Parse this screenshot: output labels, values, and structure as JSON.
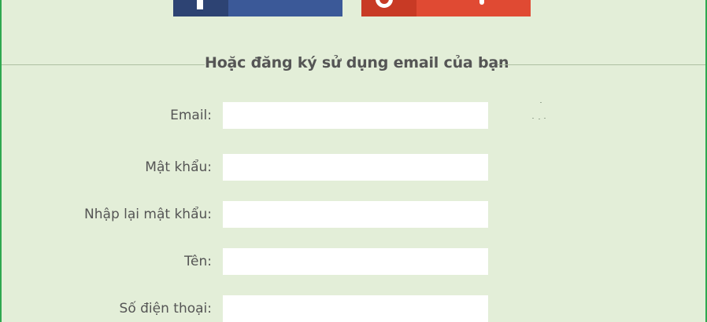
{
  "social": {
    "facebook_icon": "facebook-icon",
    "google_icon": "google-plus-icon",
    "facebook_color": "#3b5998",
    "google_color": "#e04a33"
  },
  "divider_text": "Hoặc đăng ký sử dụng email của bạn",
  "form": {
    "fields": [
      {
        "label": "Email:",
        "value": "",
        "placeholder": ""
      },
      {
        "label": "Mật khẩu:",
        "value": "",
        "placeholder": ""
      },
      {
        "label": "Nhập lại mật khẩu:",
        "value": "",
        "placeholder": ""
      },
      {
        "label": "Tên:",
        "value": "",
        "placeholder": ""
      },
      {
        "label": "Số điện thoại:",
        "value": "",
        "placeholder": ""
      }
    ]
  },
  "colors": {
    "page_background": "#e3eed8",
    "border_accent": "#2fa84f",
    "label_text": "#555555"
  }
}
